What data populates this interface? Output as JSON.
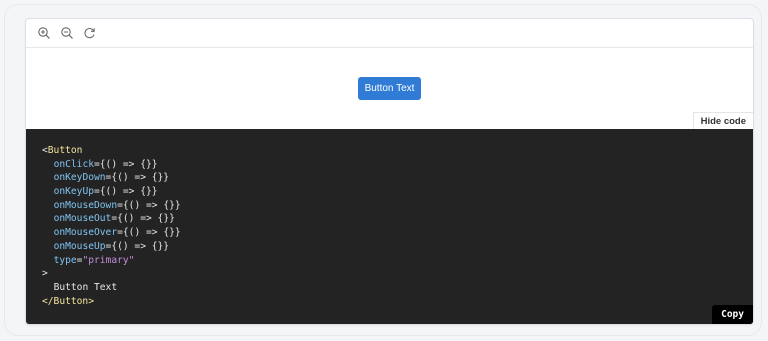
{
  "toolbar": {
    "icons": [
      "zoom-in-icon",
      "zoom-out-icon",
      "reset-icon"
    ]
  },
  "preview": {
    "button_label": "Button Text",
    "button_color": "#2f7bd6"
  },
  "hide_code_label": "Hide code",
  "copy_label": "Copy",
  "code": {
    "open_tag_bracket": "<",
    "component": "Button",
    "props": [
      {
        "name": "onClick",
        "value": "{() => {}}"
      },
      {
        "name": "onKeyDown",
        "value": "{() => {}}"
      },
      {
        "name": "onKeyUp",
        "value": "{() => {}}"
      },
      {
        "name": "onMouseDown",
        "value": "{() => {}}"
      },
      {
        "name": "onMouseOut",
        "value": "{() => {}}"
      },
      {
        "name": "onMouseOver",
        "value": "{() => {}}"
      },
      {
        "name": "onMouseUp",
        "value": "{() => {}}"
      },
      {
        "name": "type",
        "value": "\"primary\""
      }
    ],
    "open_tag_end": ">",
    "children": "Button Text",
    "close_tag": "</Button>"
  },
  "colors": {
    "code_bg": "#232323",
    "tag": "#f3e49c",
    "attr": "#80c4f2",
    "string": "#c28fda"
  }
}
